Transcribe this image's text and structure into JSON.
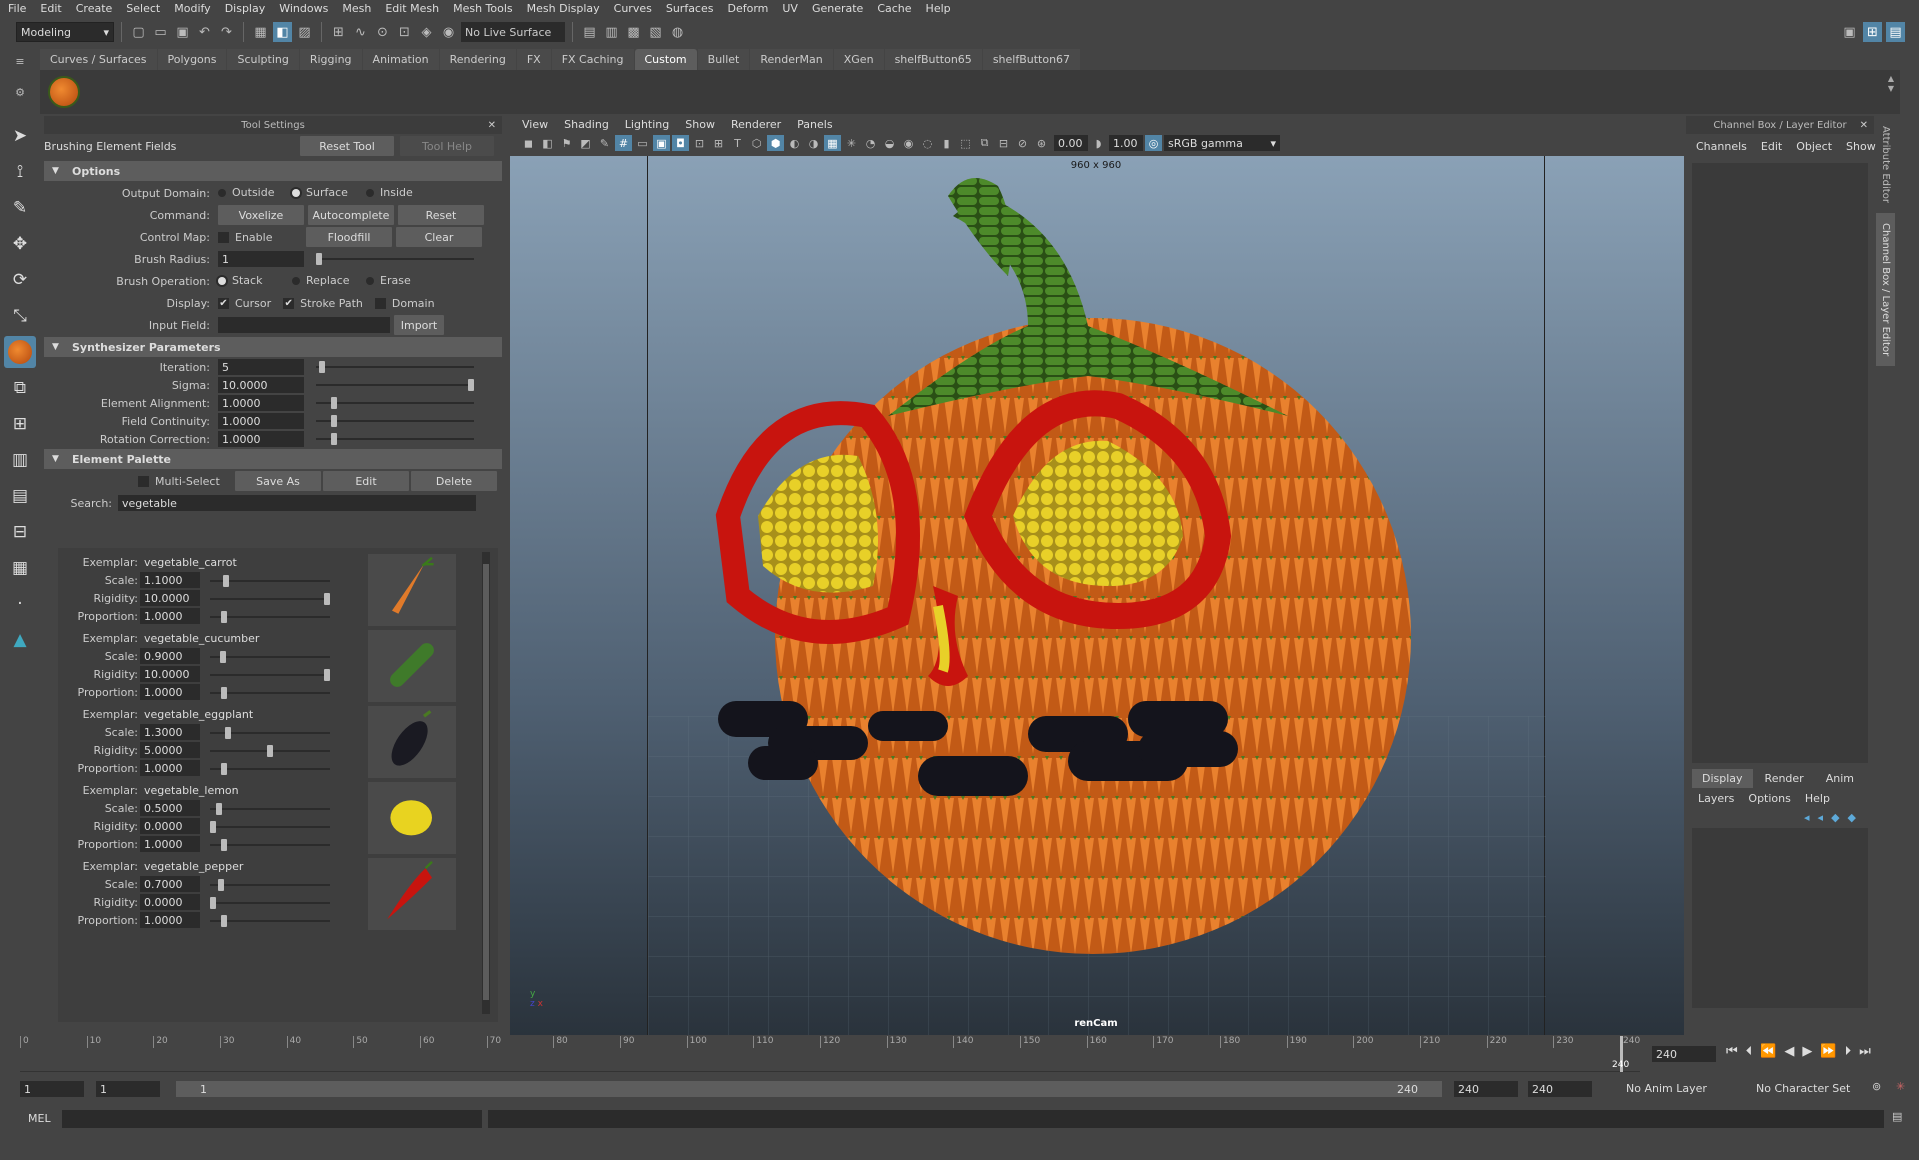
{
  "menubar": [
    "File",
    "Edit",
    "Create",
    "Select",
    "Modify",
    "Display",
    "Windows",
    "Mesh",
    "Edit Mesh",
    "Mesh Tools",
    "Mesh Display",
    "Curves",
    "Surfaces",
    "Deform",
    "UV",
    "Generate",
    "Cache",
    "Help"
  ],
  "status": {
    "mode": "Modeling",
    "live_surface": "No Live Surface"
  },
  "shelf": {
    "tabs": [
      "Curves / Surfaces",
      "Polygons",
      "Sculpting",
      "Rigging",
      "Animation",
      "Rendering",
      "FX",
      "FX Caching",
      "Custom",
      "Bullet",
      "RenderMan",
      "XGen",
      "shelfButton65",
      "shelfButton67"
    ],
    "active": "Custom"
  },
  "tool_settings": {
    "title": "Tool Settings",
    "tool_name": "Brushing Element Fields",
    "reset": "Reset Tool",
    "help": "Tool Help",
    "options": {
      "header": "Options",
      "output_domain": {
        "label": "Output Domain:",
        "choices": [
          "Outside",
          "Surface",
          "Inside"
        ],
        "selected": "Surface"
      },
      "command": {
        "label": "Command:",
        "buttons": [
          "Voxelize",
          "Autocomplete",
          "Reset"
        ]
      },
      "control_map": {
        "label": "Control Map:",
        "check": "Enable",
        "buttons": [
          "Floodfill",
          "Clear"
        ]
      },
      "brush_radius": {
        "label": "Brush Radius:",
        "value": "1",
        "fraction": 0.0
      },
      "brush_operation": {
        "label": "Brush Operation:",
        "choices": [
          "Stack",
          "Replace",
          "Erase"
        ],
        "selected": "Stack"
      },
      "display": {
        "label": "Display:",
        "checks": [
          {
            "t": "Cursor",
            "on": true
          },
          {
            "t": "Stroke Path",
            "on": true
          },
          {
            "t": "Domain",
            "on": false
          }
        ]
      },
      "input_field": {
        "label": "Input Field:",
        "value": "",
        "button": "Import"
      }
    },
    "synth": {
      "header": "Synthesizer Parameters",
      "params": [
        {
          "label": "Iteration:",
          "value": "5",
          "fraction": 0.02
        },
        {
          "label": "Sigma:",
          "value": "10.0000",
          "fraction": 1.0
        },
        {
          "label": "Element Alignment:",
          "value": "1.0000",
          "fraction": 0.1
        },
        {
          "label": "Field Continuity:",
          "value": "1.0000",
          "fraction": 0.1
        },
        {
          "label": "Rotation Correction:",
          "value": "1.0000",
          "fraction": 0.1
        }
      ]
    },
    "palette": {
      "header": "Element Palette",
      "multi": "Multi-Select",
      "buttons": [
        "Save As",
        "Edit",
        "Delete"
      ],
      "search_label": "Search:",
      "search": "vegetable",
      "exemplar_label": "Exemplar:",
      "scale_label": "Scale:",
      "rigidity_label": "Rigidity:",
      "proportion_label": "Proportion:",
      "items": [
        {
          "name": "vegetable_carrot",
          "scale": "1.1000",
          "rigidity": "10.0000",
          "proportion": "1.0000",
          "sf": 0.11,
          "rf": 1.0,
          "pf": 0.1,
          "icon": "carrot-icon",
          "color": "#e07a2a"
        },
        {
          "name": "vegetable_cucumber",
          "scale": "0.9000",
          "rigidity": "10.0000",
          "proportion": "1.0000",
          "sf": 0.09,
          "rf": 1.0,
          "pf": 0.1,
          "icon": "cucumber-icon",
          "color": "#3f7a2a"
        },
        {
          "name": "vegetable_eggplant",
          "scale": "1.3000",
          "rigidity": "5.0000",
          "proportion": "1.0000",
          "sf": 0.13,
          "rf": 0.5,
          "pf": 0.1,
          "icon": "eggplant-icon",
          "color": "#1a1a22"
        },
        {
          "name": "vegetable_lemon",
          "scale": "0.5000",
          "rigidity": "0.0000",
          "proportion": "1.0000",
          "sf": 0.05,
          "rf": 0.0,
          "pf": 0.1,
          "icon": "lemon-icon",
          "color": "#e8d320"
        },
        {
          "name": "vegetable_pepper",
          "scale": "0.7000",
          "rigidity": "0.0000",
          "proportion": "1.0000",
          "sf": 0.07,
          "rf": 0.0,
          "pf": 0.1,
          "icon": "pepper-icon",
          "color": "#c8140e"
        }
      ]
    }
  },
  "viewport": {
    "menu": [
      "View",
      "Shading",
      "Lighting",
      "Show",
      "Renderer",
      "Panels"
    ],
    "exposure": "0.00",
    "gamma": "1.00",
    "colorspace": "sRGB gamma",
    "resolution": "960 x 960",
    "camera": "renCam"
  },
  "channel_box": {
    "title": "Channel Box / Layer Editor",
    "menu": [
      "Channels",
      "Edit",
      "Object",
      "Show"
    ],
    "tabs": [
      "Display",
      "Render",
      "Anim"
    ],
    "active_tab": "Display",
    "layer_menu": [
      "Layers",
      "Options",
      "Help"
    ],
    "side_tabs": [
      "Attribute Editor",
      "Channel Box / Layer Editor"
    ]
  },
  "timeline": {
    "ticks": [
      "0",
      "10",
      "20",
      "30",
      "40",
      "50",
      "60",
      "70",
      "80",
      "90",
      "100",
      "110",
      "120",
      "130",
      "140",
      "150",
      "160",
      "170",
      "180",
      "190",
      "200",
      "210",
      "220",
      "230",
      "240"
    ],
    "current": "240",
    "current_field": "240"
  },
  "range": {
    "start": "1",
    "anim_start": "1",
    "slider_start": "1",
    "slider_end": "240",
    "anim_end": "240",
    "end": "240",
    "anim_layer": "No Anim Layer",
    "char_set": "No Character Set"
  },
  "cmdline": {
    "label": "MEL"
  }
}
